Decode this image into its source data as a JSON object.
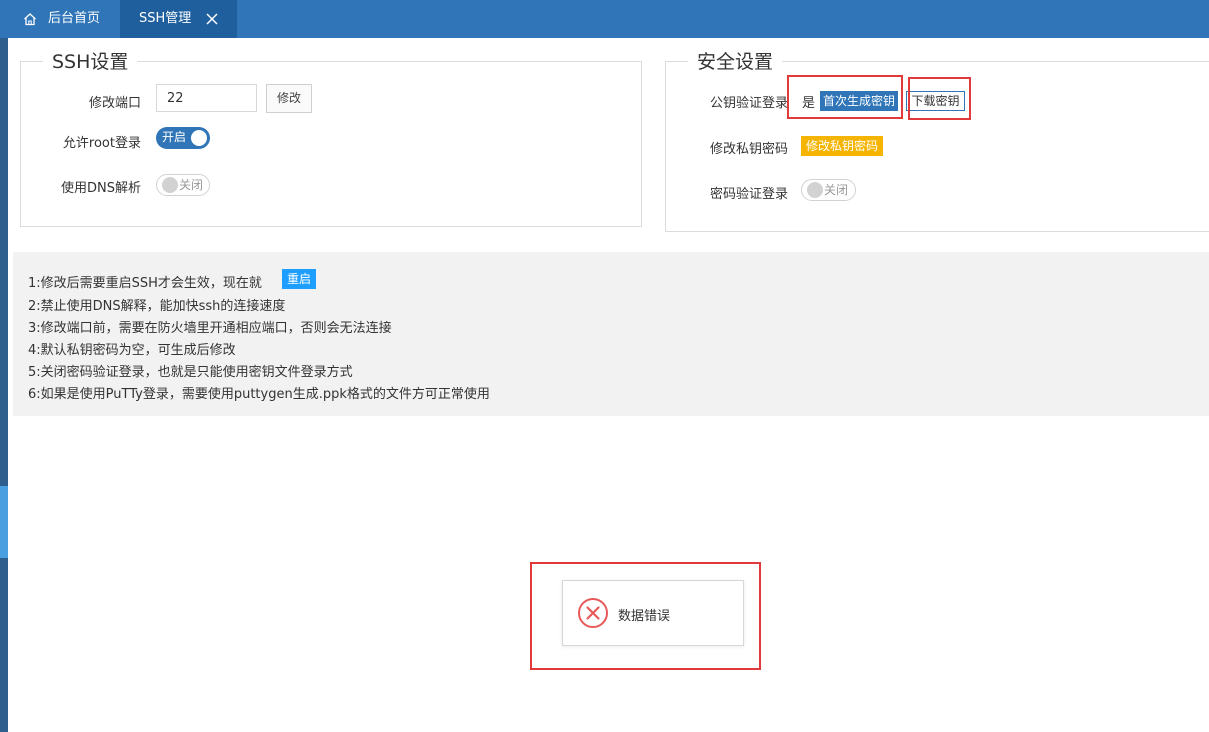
{
  "tabs": {
    "home_label": "后台首页",
    "ssh_label": "SSH管理"
  },
  "ssh_settings": {
    "title": "SSH设置",
    "port_label": "修改端口",
    "port_value": "22",
    "port_button": "修改",
    "root_label": "允许root登录",
    "root_toggle_text": "开启",
    "dns_label": "使用DNS解析",
    "dns_toggle_text": "关闭"
  },
  "security_settings": {
    "title": "安全设置",
    "pubkey_label": "公钥验证登录",
    "pubkey_status": "是",
    "generate_key_button": "首次生成密钥",
    "download_key_button": "下载密钥",
    "private_key_label": "修改私钥密码",
    "private_key_button": "修改私钥密码",
    "password_login_label": "密码验证登录",
    "password_toggle_text": "关闭"
  },
  "notes": {
    "line1_text": "1:修改后需要重启SSH才会生效，现在就",
    "restart_button": "重启",
    "line2": "2:禁止使用DNS解释，能加快ssh的连接速度",
    "line3": "3:修改端口前，需要在防火墙里开通相应端口，否则会无法连接",
    "line4": "4:默认私钥密码为空，可生成后修改",
    "line5": "5:关闭密码验证登录，也就是只能使用密钥文件登录方式",
    "line6": "6:如果是使用PuTTy登录，需要使用puttygen生成.ppk格式的文件方可正常使用"
  },
  "toast": {
    "message": "数据错误"
  },
  "colors": {
    "topbar": "#2f75b8",
    "active_tab": "#1f5f9e",
    "primary": "#2f75b8",
    "warning": "#f5b400",
    "info": "#1e9fff",
    "highlight_box": "#e23a3a",
    "error": "#e85a5a"
  },
  "icons": {
    "home": "home-icon",
    "close": "close-icon",
    "error": "error-circle-icon"
  }
}
